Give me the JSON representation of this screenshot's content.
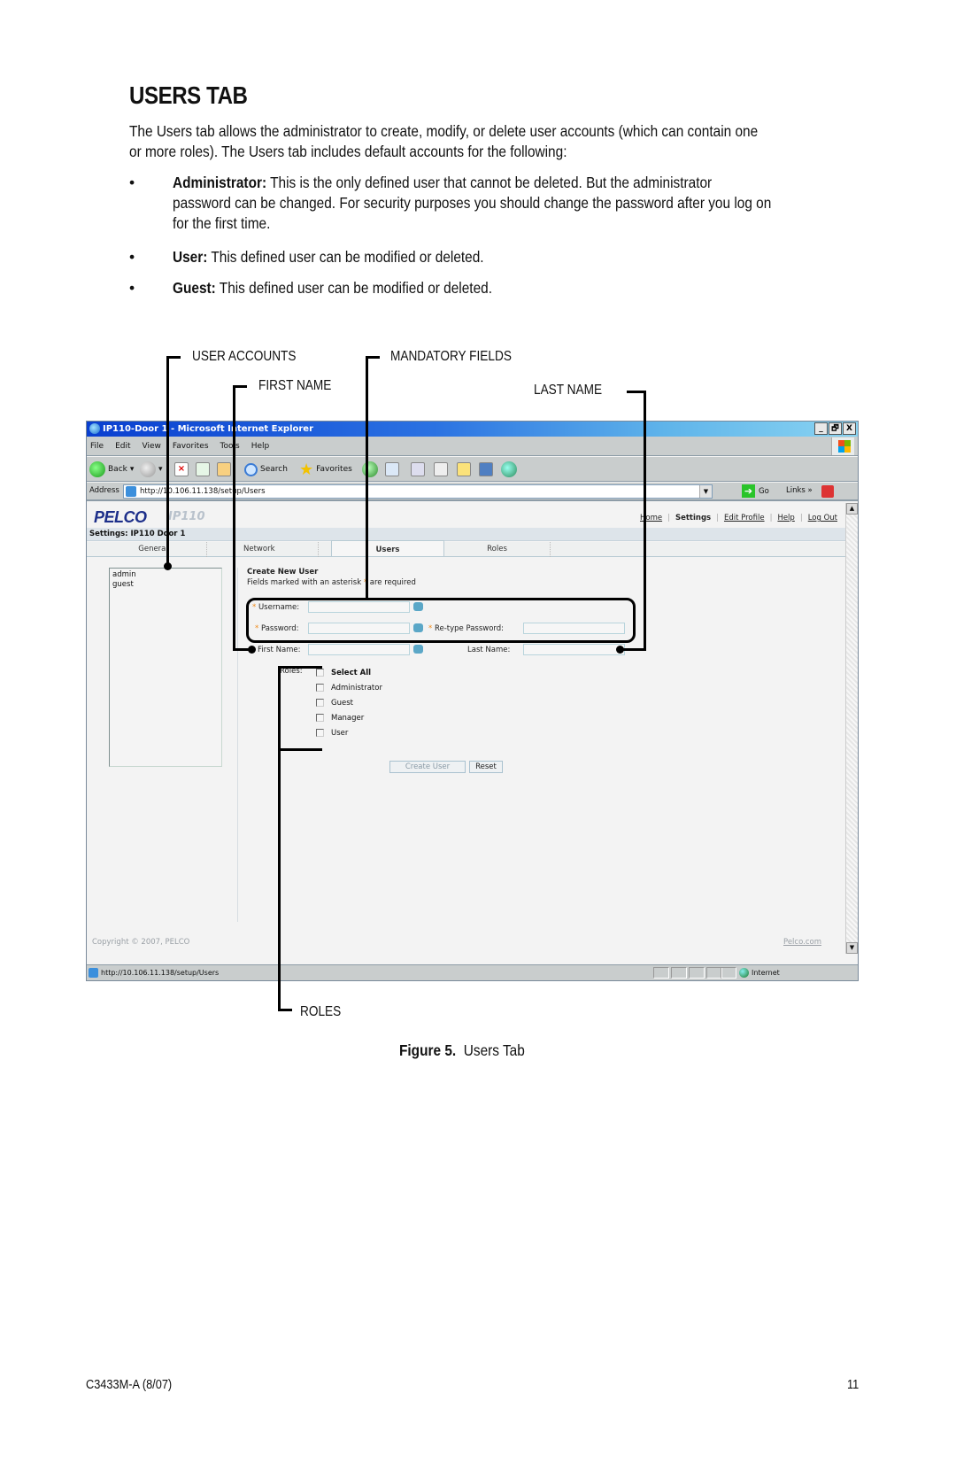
{
  "document": {
    "heading": "USERS TAB",
    "intro": "The Users tab allows the administrator to create, modify, or delete user accounts (which can contain one or more roles). The Users tab includes default accounts for the following:",
    "intro_line1": "The Users tab allows the administrator to create, modify, or delete user accounts (which can contain one",
    "intro_line2": "or more roles). The Users tab includes default accounts for the following:",
    "bullets": [
      {
        "term": "Administrator:",
        "line1": " This is the only defined user that cannot be deleted. But the administrator",
        "line2": "password can be changed. For security purposes you should change the password after you log on",
        "line3": "for the first time."
      },
      {
        "term": "User:",
        "line1": " This defined user can be modified or deleted."
      },
      {
        "term": "Guest:",
        "line1": " This defined user can be modified or deleted."
      }
    ],
    "bullet_glyph": "•",
    "figure_caption_label": "Figure 5.",
    "figure_caption_text": "Users Tab",
    "footer_left": "C3433M-A (8/07)",
    "footer_right": "11"
  },
  "callouts": {
    "user_accounts": "USER ACCOUNTS",
    "first_name": "FIRST NAME",
    "mandatory_fields": "MANDATORY FIELDS",
    "last_name": "LAST NAME",
    "roles": "ROLES"
  },
  "browser": {
    "title": "IP110-Door 1 - Microsoft Internet Explorer",
    "window_buttons": [
      "_",
      "🗗",
      "X"
    ],
    "menu": [
      "File",
      "Edit",
      "View",
      "Favorites",
      "Tools",
      "Help"
    ],
    "toolbar": {
      "back": "Back",
      "search": "Search",
      "favorites": "Favorites"
    },
    "address_label": "Address",
    "address_value": "http://10.106.11.138/setup/Users",
    "go_label": "Go",
    "links_label": "Links »",
    "status_url": "http://10.106.11.138/setup/Users",
    "status_zone": "Internet"
  },
  "app": {
    "logo": "PELCO",
    "product": "IP110",
    "top_links": [
      {
        "label": "Home",
        "current": false
      },
      {
        "label": "Settings",
        "current": true
      },
      {
        "label": "Edit Profile",
        "current": false
      },
      {
        "label": "Help",
        "current": false
      },
      {
        "label": "Log Out",
        "current": false
      }
    ],
    "settings_title": "Settings: IP110 Door 1",
    "tabs": [
      {
        "label": "General",
        "active": false
      },
      {
        "label": "Network",
        "active": false
      },
      {
        "label": "Users",
        "active": true
      },
      {
        "label": "Roles",
        "active": false
      }
    ],
    "user_list": [
      "admin",
      "guest"
    ],
    "form": {
      "title": "Create New User",
      "required_note_pre": "Fields marked with an asterisk ",
      "required_note_star": "*",
      "required_note_post": " are required",
      "username_label": "Username:",
      "username_value": "",
      "password_label": "Password:",
      "password_value": "",
      "retype_label": "Re-type Password:",
      "retype_value": "",
      "first_name_label": "First Name:",
      "first_name_value": "",
      "last_name_label": "Last Name:",
      "last_name_value": "",
      "roles_label": "Roles:",
      "roles": [
        {
          "label": "Select All",
          "checked": false,
          "bold": true
        },
        {
          "label": "Administrator",
          "checked": false
        },
        {
          "label": "Guest",
          "checked": false
        },
        {
          "label": "Manager",
          "checked": false
        },
        {
          "label": "User",
          "checked": false
        }
      ],
      "create_button": "Create User",
      "reset_button": "Reset"
    },
    "copyright": "Copyright © 2007, PELCO",
    "footer_link": "Pelco.com"
  },
  "colors": {
    "required_star": "#f08a1a",
    "title_bar_start": "#0a3fd0",
    "title_bar_end": "#8ad4f2",
    "logo": "#1d2f8a"
  }
}
